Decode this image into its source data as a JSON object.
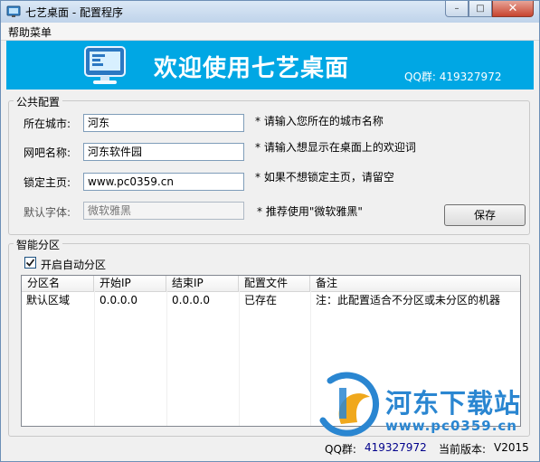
{
  "window": {
    "title": "七艺桌面 - 配置程序",
    "minimize_glyph": "–",
    "maximize_glyph": "□",
    "close_glyph": "✕"
  },
  "menu": {
    "help": "帮助菜单"
  },
  "banner": {
    "title": "欢迎使用七艺桌面",
    "qq": "QQ群: 419327972",
    "icon": "monitor-icon",
    "bg_color": "#00a7e4"
  },
  "public_config": {
    "legend": "公共配置",
    "city_label": "所在城市:",
    "city_value": "河东",
    "city_hint": "* 请输入您所在的城市名称",
    "bar_label": "网吧名称:",
    "bar_value": "河东软件园",
    "bar_hint": "* 请输入想显示在桌面上的欢迎词",
    "home_label": "锁定主页:",
    "home_value": "www.pc0359.cn",
    "home_hint": "* 如果不想锁定主页，请留空",
    "font_label": "默认字体:",
    "font_value": "微软雅黑",
    "font_hint": "* 推荐使用\"微软雅黑\"",
    "save_button": "保存"
  },
  "smart_partition": {
    "legend": "智能分区",
    "auto_checkbox_label": "开启自动分区",
    "auto_checked": true,
    "columns": [
      "分区名",
      "开始IP",
      "结束IP",
      "配置文件",
      "备注"
    ],
    "rows": [
      [
        "默认区域",
        "0.0.0.0",
        "0.0.0.0",
        "已存在",
        "注：此配置适合不分区或未分区的机器"
      ]
    ]
  },
  "status": {
    "qq_label": "QQ群:",
    "qq_value": "419327972",
    "version_label": "当前版本:",
    "version_value": "V2015"
  },
  "watermark": {
    "name": "河东下载站",
    "url": "www.pc0359.cn",
    "color": "#2a86d1"
  }
}
